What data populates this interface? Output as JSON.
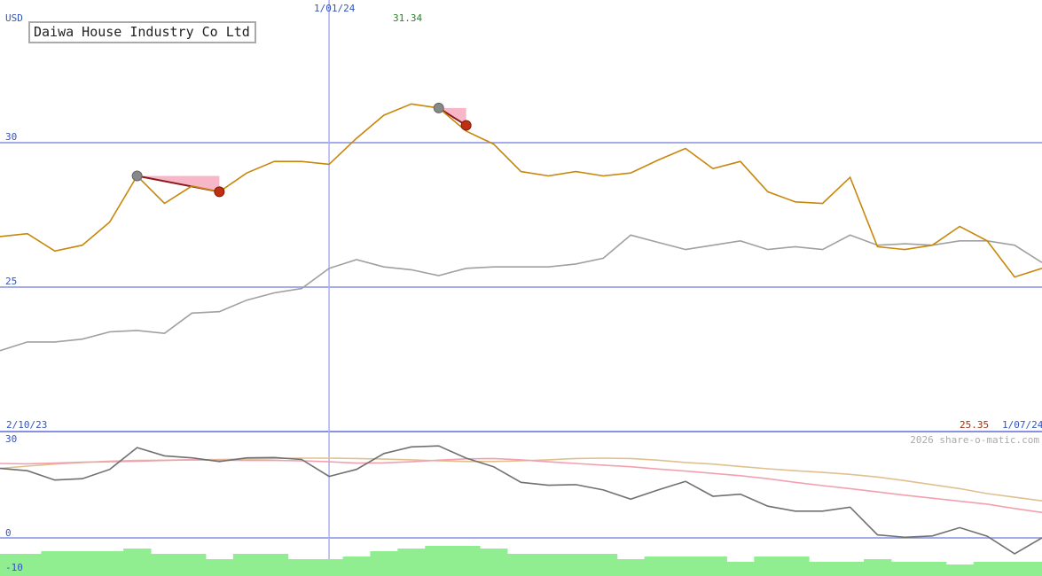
{
  "title": "Daiwa House Industry Co Ltd",
  "currency": "USD",
  "marker_date": "1/01/24",
  "peak_value": "31.34",
  "start_date": "2/10/23",
  "end_date": "1/07/24",
  "last_value": "25.35",
  "copyright": "2026 share-o-matic.com",
  "colors": {
    "price": "#c8860a",
    "compare": "#a0a0a0",
    "grid": "#8890e0",
    "axis_text": "#3355bb",
    "peak_text": "#228822",
    "last_text": "#993311",
    "osc": "#707070",
    "ma_pink": "#f2a0b0",
    "ma_tan": "#e0c090",
    "volume": "#90ee90",
    "trade_fill": "#f7b7c8",
    "trade_line": "#8b1a1a",
    "buy_dot": "#888888",
    "sell_dot": "#c03010"
  },
  "chart_data": [
    {
      "type": "line",
      "title": "Daiwa House Industry Co Ltd",
      "ylabel": "USD",
      "xlabel": "",
      "x_range": [
        "2/10/23",
        "1/07/24"
      ],
      "ylim": [
        20.0,
        32.5
      ],
      "yticks": [
        25,
        30
      ],
      "grid": true,
      "series": [
        {
          "values": [
            26.75,
            26.85,
            26.25,
            26.45,
            27.25,
            28.85,
            27.9,
            28.5,
            28.3,
            28.95,
            29.35,
            29.35,
            29.25,
            30.15,
            30.95,
            31.34,
            31.2,
            30.4,
            29.95,
            29.0,
            28.85,
            29.0,
            28.85,
            28.95,
            29.4,
            29.8,
            29.1,
            29.35,
            28.3,
            27.95,
            27.9,
            28.8,
            26.4,
            26.3,
            26.45,
            27.1,
            26.6,
            25.35,
            25.65
          ]
        },
        {
          "values": [
            22.8,
            23.1,
            23.1,
            23.2,
            23.45,
            23.5,
            23.4,
            24.1,
            24.15,
            24.55,
            24.8,
            24.95,
            25.65,
            25.95,
            25.7,
            25.6,
            25.4,
            25.65,
            25.7,
            25.7,
            25.7,
            25.8,
            26.0,
            26.8,
            26.55,
            26.3,
            26.45,
            26.6,
            26.3,
            26.4,
            26.3,
            26.8,
            26.45,
            26.5,
            26.45,
            26.6,
            26.6,
            26.45,
            25.85
          ]
        }
      ],
      "trades": [
        {
          "buy_index": 5,
          "buy_value": 28.85,
          "sell_index": 8,
          "sell_value": 28.3
        },
        {
          "buy_index": 16,
          "buy_value": 31.2,
          "sell_index": 17,
          "sell_value": 30.6
        }
      ],
      "marker_index": 12
    },
    {
      "type": "line",
      "title": "",
      "ylim": [
        -10,
        30
      ],
      "yticks": [
        30,
        0,
        -10
      ],
      "grid": true,
      "series": [
        {
          "values": [
            21,
            20.3,
            17.5,
            17.9,
            20.7,
            27.3,
            24.8,
            24.2,
            23.1,
            24.2,
            24.3,
            23.7,
            18.6,
            20.7,
            25.5,
            27.5,
            27.8,
            24.1,
            21.5,
            16.8,
            15.9,
            16.1,
            14.5,
            11.7,
            14.5,
            17.1,
            12.6,
            13.2,
            9.6,
            8.1,
            8.1,
            9.3,
            0.9,
            0.2,
            0.6,
            3.1,
            0.5,
            -4.8,
            0
          ]
        },
        {
          "values": [
            22.5,
            22.4,
            22.6,
            22.9,
            23.0,
            23.2,
            23.4,
            23.6,
            23.5,
            23.4,
            23.4,
            23.3,
            23.0,
            22.6,
            22.7,
            23.0,
            23.5,
            23.9,
            24.0,
            23.6,
            23.0,
            22.5,
            22.0,
            21.5,
            20.8,
            20.2,
            19.5,
            18.8,
            17.9,
            16.8,
            15.8,
            14.9,
            13.9,
            12.9,
            12.0,
            11.1,
            10.2,
            8.9,
            7.7
          ]
        },
        {
          "values": [
            21.0,
            21.7,
            22.3,
            22.8,
            23.2,
            23.4,
            23.5,
            23.6,
            23.7,
            23.8,
            24.0,
            24.1,
            24.1,
            24.0,
            23.8,
            23.6,
            23.3,
            23.1,
            23.1,
            23.3,
            23.6,
            24.0,
            24.1,
            24.0,
            23.5,
            22.8,
            22.3,
            21.6,
            20.9,
            20.3,
            19.8,
            19.2,
            18.4,
            17.3,
            16.1,
            14.9,
            13.4,
            12.3,
            11.2
          ]
        }
      ],
      "volume": [
        5,
        5,
        6,
        6,
        6,
        7,
        5,
        5,
        3,
        5,
        5,
        3,
        3,
        4,
        6,
        7,
        8,
        8,
        7,
        5,
        5,
        5,
        5,
        3,
        4,
        4,
        4,
        2,
        4,
        4,
        2,
        2,
        3,
        2,
        2,
        1,
        2,
        2,
        2
      ]
    }
  ]
}
